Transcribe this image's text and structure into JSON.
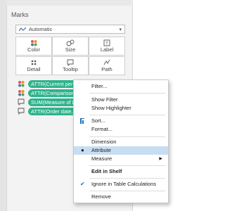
{
  "marks": {
    "title": "Marks",
    "mark_type": "Automatic",
    "tiles": [
      {
        "label": "Color",
        "icon": "color-dots-icon"
      },
      {
        "label": "Size",
        "icon": "size-icon"
      },
      {
        "label": "Label",
        "icon": "label-icon"
      },
      {
        "label": "Detail",
        "icon": "detail-icon"
      },
      {
        "label": "Tooltip",
        "icon": "tooltip-icon"
      },
      {
        "label": "Path",
        "icon": "path-icon"
      }
    ],
    "pills": [
      {
        "text": "ATTR(Current period TVS)",
        "icon": "color-dots-icon"
      },
      {
        "text": "ATTR(Comparison period TVS)",
        "icon": "color-dots-icon"
      },
      {
        "text": "SUM(Measure of interest)",
        "icon": "tooltip-icon"
      },
      {
        "text": "ATTR(Order date, fixed)",
        "icon": "tooltip-icon"
      }
    ]
  },
  "context_menu": {
    "items": [
      {
        "label": "Filter...",
        "bold": false
      },
      {
        "label": "Show Filter",
        "bold": false
      },
      {
        "label": "Show Highlighter",
        "bold": false
      },
      {
        "label": "Sort...",
        "bold": false,
        "icon": "sort-icon"
      },
      {
        "label": "Format...",
        "bold": false
      },
      {
        "label": "Dimension",
        "bold": false
      },
      {
        "label": "Attribute",
        "bold": false,
        "selected": true,
        "icon": "bullet-icon"
      },
      {
        "label": "Measure",
        "bold": false,
        "submenu": true
      },
      {
        "label": "Edit in Shelf",
        "bold": true
      },
      {
        "label": "Ignore in Table Calculations",
        "bold": false,
        "icon": "check-icon"
      },
      {
        "label": "Remove",
        "bold": false
      }
    ]
  },
  "colors": {
    "pill": "#2fb38b",
    "selected_row": "#c7ddf2",
    "check": "#1f6fb6"
  }
}
